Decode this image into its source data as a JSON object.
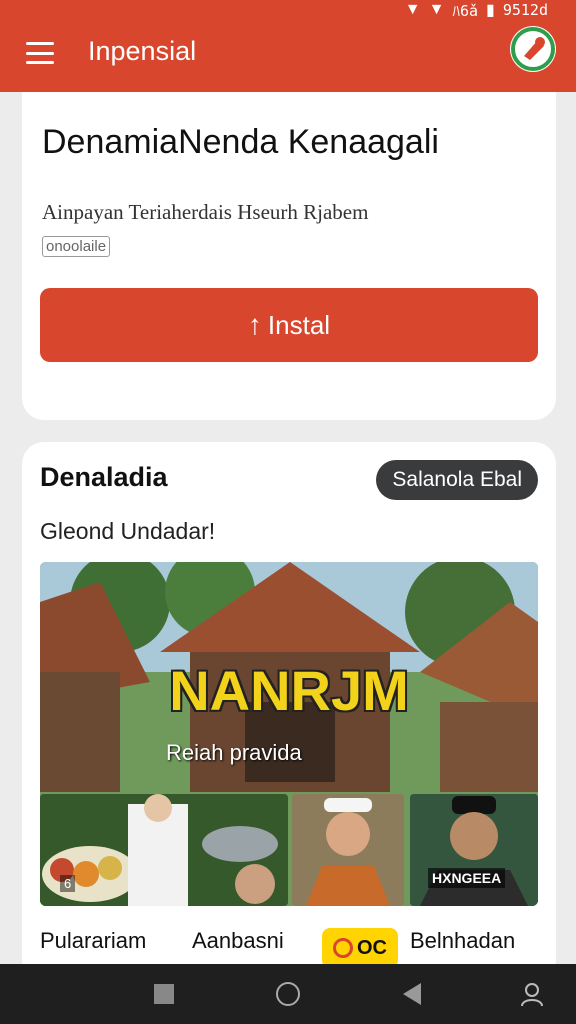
{
  "status": {
    "text": "9512d",
    "carrier": "ﾊ6ǎ"
  },
  "appbar": {
    "title": "Inpensial"
  },
  "install_card": {
    "headline": "DenamiaNenda Kenaagali",
    "subtitle": "Ainpayan Teriaherdais Hseurh Rjabem",
    "tag": "onoolaile",
    "install_label": "Instal",
    "install_icon": "upload-arrow-icon"
  },
  "section": {
    "title": "Denaladia",
    "view_all_label": "Salanola Ebal",
    "subtitle": "Gleond Undadar!",
    "hero_title": "NANRJM",
    "hero_caption": "Reiah pravida",
    "thumb_overlay": "6",
    "thumb3_overlay": "HXNGEEA"
  },
  "categories": {
    "items": [
      "Pularariam",
      "Aanbasni",
      "OC",
      "Belnhadan"
    ]
  },
  "colors": {
    "primary": "#d7462d",
    "dark_button": "#3a3b3d",
    "badge": "#ffd400"
  }
}
